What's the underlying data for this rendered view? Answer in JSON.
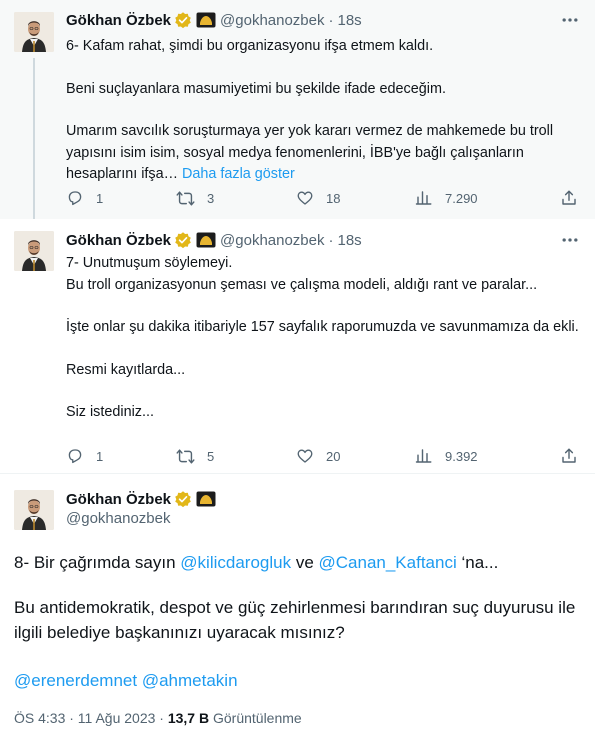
{
  "author": {
    "name": "Gökhan Özbek",
    "handle": "@gokhanozbek",
    "time": "18s",
    "dot": "·"
  },
  "colors": {
    "link": "#1d9bf0",
    "verified": "#e2b719",
    "text": "#0f1419",
    "muted": "#536471"
  },
  "tweets": [
    {
      "lines": [
        "6- Kafam rahat, şimdi bu organizasyonu ifşa etmem kaldı.",
        "Beni suçlayanlara masumiyetimi bu şekilde ifade edeceğim.",
        "Umarım savcılık soruşturmaya yer yok kararı vermez de mahkemede bu troll yapısını isim isim, sosyal medya fenomenlerini, İBB'ye bağlı çalışanların hesaplarını ifşa… "
      ],
      "show_more": "Daha fazla göster",
      "replies": "1",
      "retweets": "3",
      "likes": "18",
      "views": "7.290"
    },
    {
      "lines": [
        "7- Unutmuşum söylemeyi.\nBu troll organizasyonun şeması ve çalışma modeli, aldığı rant ve paralar...",
        "İşte onlar şu dakika itibariyle 157 sayfalık raporumuzda ve savunmamıza da ekli.",
        "Resmi kayıtlarda...",
        "Siz istediniz..."
      ],
      "replies": "1",
      "retweets": "5",
      "likes": "20",
      "views": "9.392"
    },
    {
      "text_prefix": "8- Bir çağrımda sayın ",
      "mention1": "@kilicdarogluk",
      "connector": " ve ",
      "mention2": "@Canan_Kaftanci",
      "text_suffix": " ‘na...",
      "paragraph2": "Bu antidemokratik, despot ve güç zehirlenmesi barındıran suç duyurusu ile ilgili belediye başkanınızı uyaracak mısınız?",
      "mention3": "@erenerdemnet",
      "mention4": "@ahmetakin",
      "time": "ÖS 4:33 · 11 Ağu 2023 · ",
      "views_count": "13,7 B",
      "views_label": " Görüntülenme"
    }
  ],
  "icons": [
    "reply-icon",
    "retweet-icon",
    "like-icon",
    "views-icon",
    "share-icon",
    "more-icon",
    "verified-icon"
  ]
}
